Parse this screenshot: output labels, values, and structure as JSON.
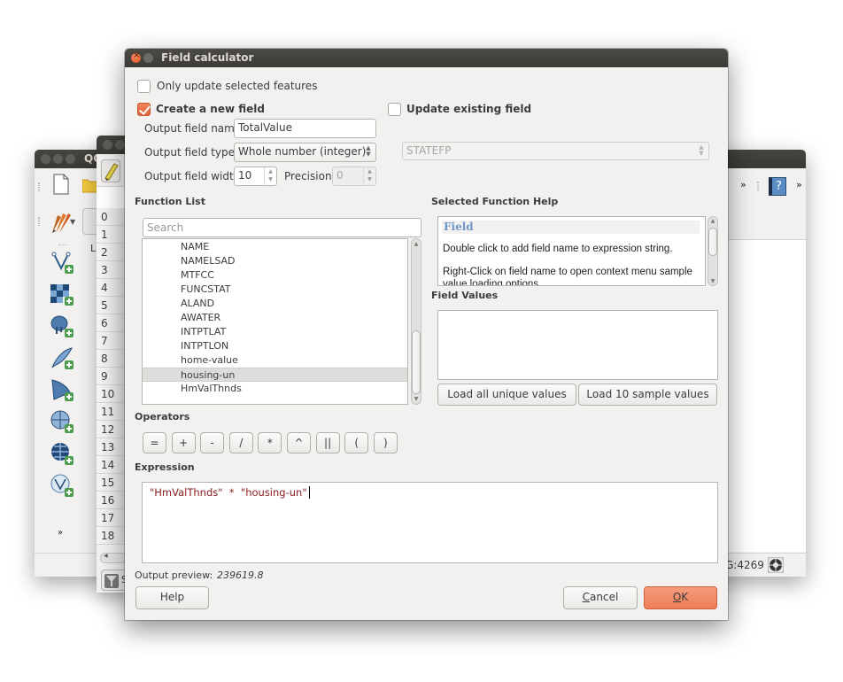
{
  "background_main_window": {
    "title_fragment": "QG",
    "epsg_fragment": "G:4269",
    "left_toolbar_icons": [
      "add-vector-layer-icon",
      "add-raster-layer-icon",
      "add-postgis-layer-icon",
      "add-spatialite-layer-icon",
      "add-mssql-layer-icon",
      "add-wms-layer-icon",
      "add-wcs-layer-icon",
      "add-wfs-layer-icon"
    ],
    "layers_label_fragment": "La"
  },
  "background_attribute_window": {
    "row_numbers": [
      "0",
      "1",
      "2",
      "3",
      "4",
      "5",
      "6",
      "7",
      "8",
      "9",
      "10",
      "11",
      "12",
      "13",
      "14",
      "15",
      "16",
      "17",
      "18"
    ],
    "status_fragment": "S"
  },
  "dialog": {
    "title": "Field calculator",
    "only_selected": {
      "label": "Only update selected features",
      "checked": false
    },
    "create_new": {
      "label": "Create a new field",
      "checked": true
    },
    "update_existing": {
      "label": "Update existing field",
      "checked": false,
      "field": "STATEFP"
    },
    "output_name": {
      "label": "Output field name",
      "value": "TotalValue"
    },
    "output_type": {
      "label": "Output field type",
      "value": "Whole number (integer)"
    },
    "output_width": {
      "label": "Output field width",
      "value": "10"
    },
    "precision": {
      "label": "Precision",
      "value": "0"
    },
    "function_list": {
      "title": "Function List",
      "search_placeholder": "Search",
      "items": [
        "NAME",
        "NAMELSAD",
        "MTFCC",
        "FUNCSTAT",
        "ALAND",
        "AWATER",
        "INTPTLAT",
        "INTPTLON",
        "home-value",
        "housing-un",
        "HmValThnds"
      ],
      "selected": "housing-un"
    },
    "function_help": {
      "title": "Selected Function Help",
      "heading": "Field",
      "line1": "Double click to add field name to expression string.",
      "line2": "Right-Click on field name to open context menu sample",
      "line3": "value loading options."
    },
    "field_values": {
      "title": "Field Values",
      "load_all": "Load all unique values",
      "load_sample": "Load 10 sample values"
    },
    "operators": {
      "title": "Operators",
      "items": [
        "=",
        "+",
        "-",
        "/",
        "*",
        "^",
        "||",
        "(",
        ")"
      ]
    },
    "expression": {
      "title": "Expression",
      "value": "\"HmValThnds\"  *  \"housing-un\""
    },
    "output_preview": {
      "label": "Output preview:",
      "value": "239619.8"
    },
    "buttons": {
      "help": "Help",
      "cancel_prefix": "C",
      "cancel_rest": "ancel",
      "ok_prefix": "O",
      "ok_rest": "K"
    },
    "colors": {
      "accent": "#ee7f58",
      "help_heading": "#6d98c9",
      "expression_text": "#8b1a1a"
    }
  }
}
